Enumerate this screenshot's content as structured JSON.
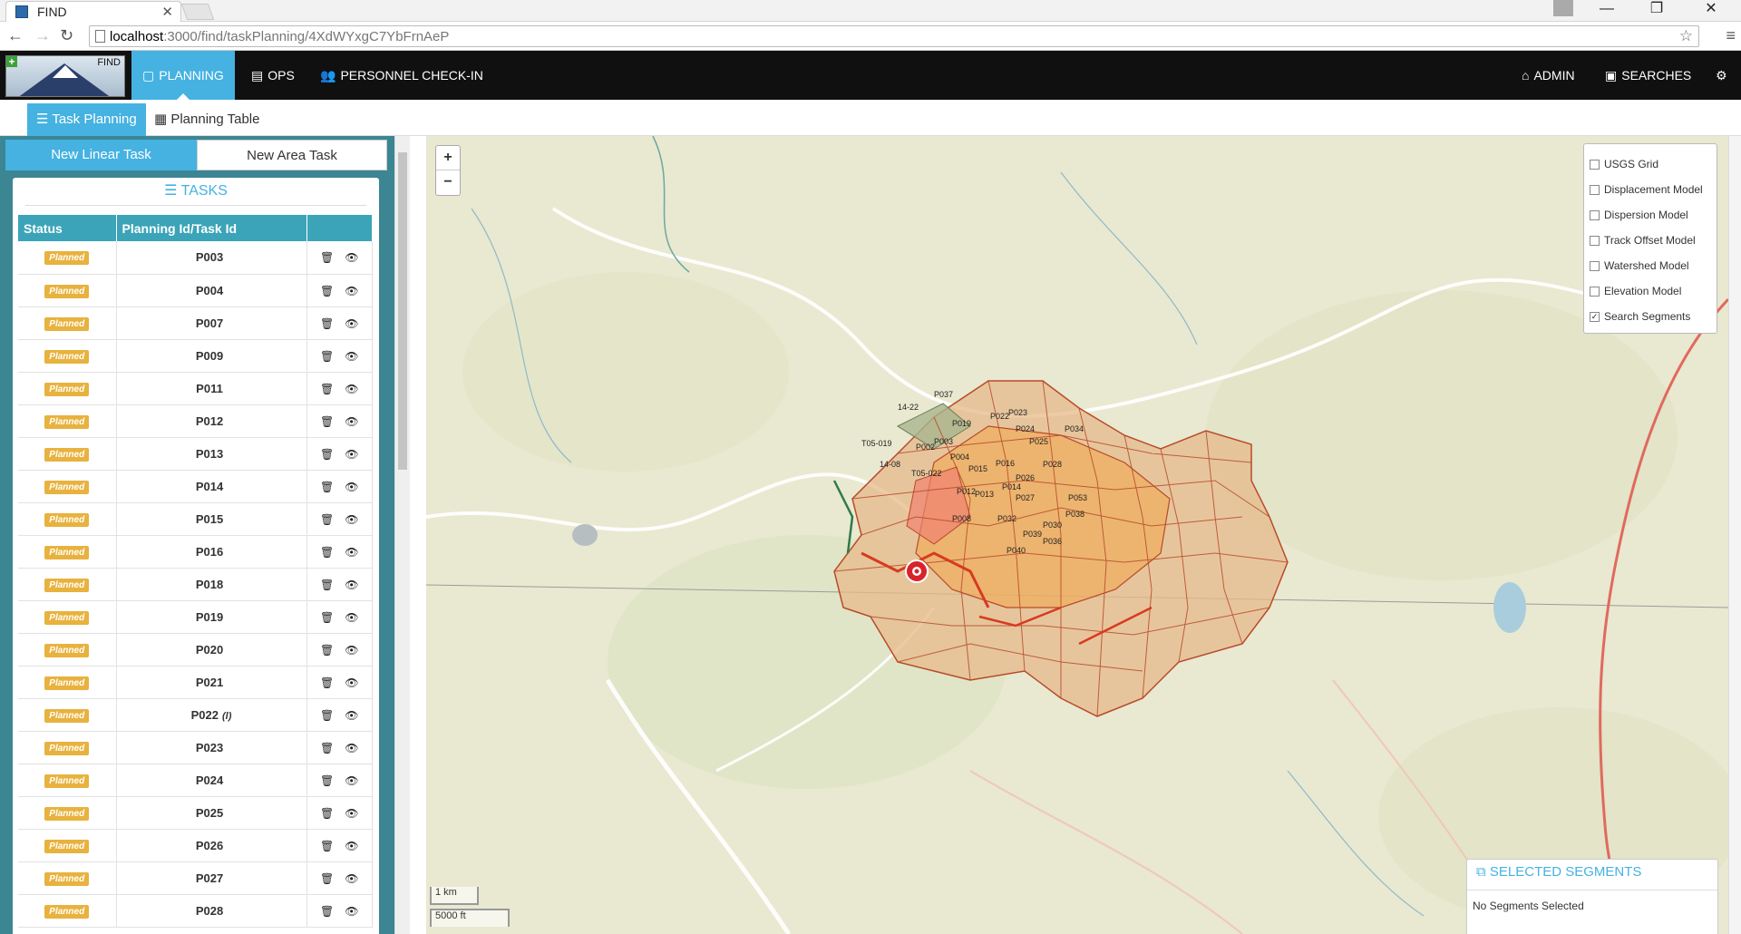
{
  "browser": {
    "tab_title": "FIND",
    "url_host": "localhost",
    "url_rest": ":3000/find/taskPlanning/4XdWYxgC7YbFrnAeP"
  },
  "navbar": {
    "logo_text": "FIND",
    "items": [
      {
        "label": "PLANNING",
        "icon": "map-icon"
      },
      {
        "label": "OPS",
        "icon": "document-icon"
      },
      {
        "label": "PERSONNEL CHECK-IN",
        "icon": "users-icon"
      }
    ],
    "right": [
      {
        "label": "ADMIN",
        "icon": "home-icon"
      },
      {
        "label": "SEARCHES",
        "icon": "archive-icon"
      }
    ]
  },
  "subnav": {
    "task_planning": "Task Planning",
    "planning_table": "Planning Table"
  },
  "sidebar": {
    "new_linear": "New Linear Task",
    "new_area": "New Area Task",
    "tasks_header": "TASKS",
    "columns": [
      "Status",
      "Planning Id/Task Id",
      ""
    ],
    "rows": [
      {
        "status": "Planned",
        "id": "P003",
        "note": ""
      },
      {
        "status": "Planned",
        "id": "P004",
        "note": ""
      },
      {
        "status": "Planned",
        "id": "P007",
        "note": ""
      },
      {
        "status": "Planned",
        "id": "P009",
        "note": ""
      },
      {
        "status": "Planned",
        "id": "P011",
        "note": ""
      },
      {
        "status": "Planned",
        "id": "P012",
        "note": ""
      },
      {
        "status": "Planned",
        "id": "P013",
        "note": ""
      },
      {
        "status": "Planned",
        "id": "P014",
        "note": ""
      },
      {
        "status": "Planned",
        "id": "P015",
        "note": ""
      },
      {
        "status": "Planned",
        "id": "P016",
        "note": ""
      },
      {
        "status": "Planned",
        "id": "P018",
        "note": ""
      },
      {
        "status": "Planned",
        "id": "P019",
        "note": ""
      },
      {
        "status": "Planned",
        "id": "P020",
        "note": ""
      },
      {
        "status": "Planned",
        "id": "P021",
        "note": ""
      },
      {
        "status": "Planned",
        "id": "P022",
        "note": "(l)"
      },
      {
        "status": "Planned",
        "id": "P023",
        "note": ""
      },
      {
        "status": "Planned",
        "id": "P024",
        "note": ""
      },
      {
        "status": "Planned",
        "id": "P025",
        "note": ""
      },
      {
        "status": "Planned",
        "id": "P026",
        "note": ""
      },
      {
        "status": "Planned",
        "id": "P027",
        "note": ""
      },
      {
        "status": "Planned",
        "id": "P028",
        "note": ""
      }
    ]
  },
  "map": {
    "layers": [
      {
        "label": "USGS Grid",
        "checked": false
      },
      {
        "label": "Displacement Model",
        "checked": false
      },
      {
        "label": "Dispersion Model",
        "checked": false
      },
      {
        "label": "Track Offset Model",
        "checked": false
      },
      {
        "label": "Watershed Model",
        "checked": false
      },
      {
        "label": "Elevation Model",
        "checked": false
      },
      {
        "label": "Search Segments",
        "checked": true
      }
    ],
    "scale_metric": "1 km",
    "scale_imperial": "5000 ft",
    "segment_labels": [
      "P037",
      "14-22",
      "P019",
      "P022",
      "P023",
      "P024",
      "P025",
      "P034",
      "P003",
      "P002",
      "P004",
      "P015",
      "P016",
      "P026",
      "P028",
      "P012",
      "P013",
      "P014",
      "P027",
      "P053",
      "P008",
      "P032",
      "P030",
      "P038",
      "P039",
      "P040",
      "P036",
      "14-08",
      "T05-019",
      "T05-022"
    ],
    "colors": {
      "segment_fill": "#e6b98a",
      "segment_stroke": "#b84a2a",
      "inner_fill": "#f2a64b",
      "hot": "#f08070"
    }
  },
  "selected_segments": {
    "title": "SELECTED SEGMENTS",
    "empty": "No Segments Selected"
  }
}
